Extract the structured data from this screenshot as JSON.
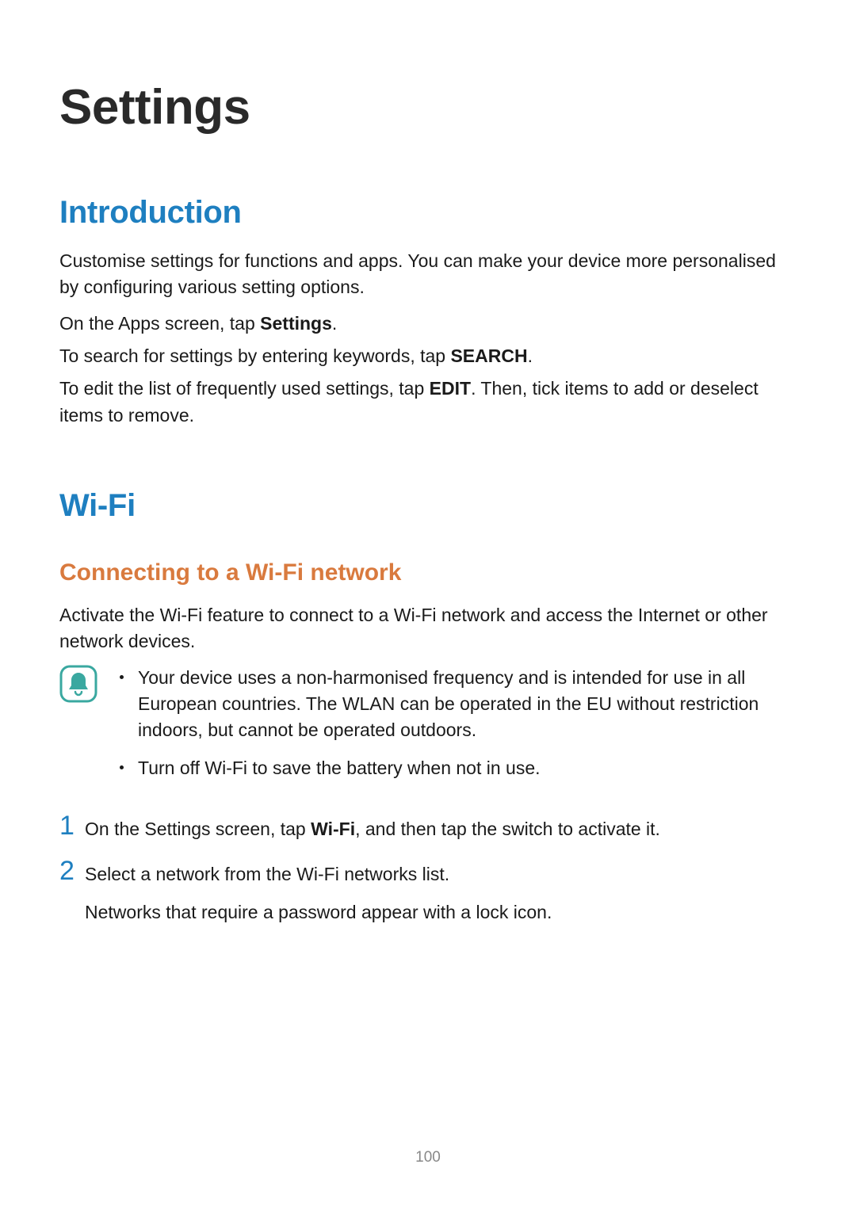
{
  "page": {
    "title": "Settings",
    "number": "100"
  },
  "introduction": {
    "heading": "Introduction",
    "p1": "Customise settings for functions and apps. You can make your device more personalised by configuring various setting options.",
    "p2_prefix": "On the Apps screen, tap ",
    "p2_bold": "Settings",
    "p2_suffix": ".",
    "p3_prefix": "To search for settings by entering keywords, tap ",
    "p3_bold": "SEARCH",
    "p3_suffix": ".",
    "p4_prefix": "To edit the list of frequently used settings, tap ",
    "p4_bold": "EDIT",
    "p4_suffix": ". Then, tick items to add or deselect items to remove."
  },
  "wifi": {
    "heading": "Wi-Fi",
    "subheading": "Connecting to a Wi-Fi network",
    "intro": "Activate the Wi-Fi feature to connect to a Wi-Fi network and access the Internet or other network devices.",
    "notes": [
      "Your device uses a non-harmonised frequency and is intended for use in all European countries. The WLAN can be operated in the EU without restriction indoors, but cannot be operated outdoors.",
      "Turn off Wi-Fi to save the battery when not in use."
    ],
    "steps": [
      {
        "num": "1",
        "text_prefix": "On the Settings screen, tap ",
        "text_bold": "Wi-Fi",
        "text_suffix": ", and then tap the switch to activate it."
      },
      {
        "num": "2",
        "text_prefix": "Select a network from the Wi-Fi networks list.",
        "text_bold": "",
        "text_suffix": "",
        "subtext": "Networks that require a password appear with a lock icon."
      }
    ]
  }
}
